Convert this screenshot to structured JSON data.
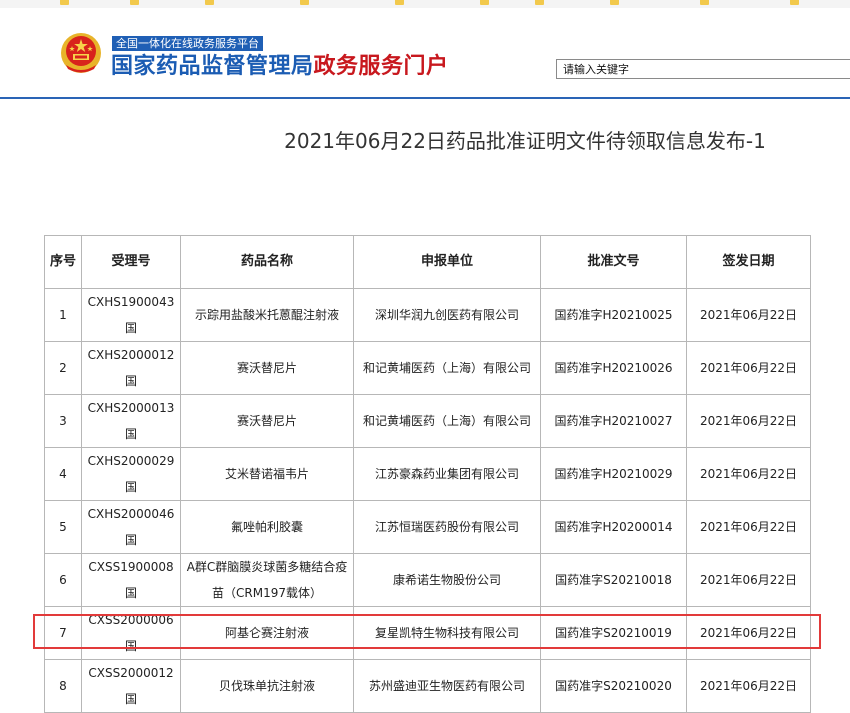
{
  "header": {
    "tagline": "全国一体化在线政务服务平台",
    "title_blue": "国家药品监督管理局",
    "title_red": "政务服务门户",
    "search_placeholder": "请输入关键字",
    "emblem_icon": "national-emblem-icon",
    "colors": {
      "brand_blue": "#1b5cb3",
      "brand_red": "#c8181e",
      "highlight": "#e23a3a"
    }
  },
  "page": {
    "title": "2021年06月22日药品批准证明文件待领取信息发布-1"
  },
  "table": {
    "columns": [
      "序号",
      "受理号",
      "药品名称",
      "申报单位",
      "批准文号",
      "签发日期"
    ],
    "rows": [
      {
        "no": "1",
        "accept": "CXHS1900043国",
        "drug": "示踪用盐酸米托蒽醌注射液",
        "applicant": "深圳华润九创医药有限公司",
        "approval": "国药准字H20210025",
        "date": "2021年06月22日"
      },
      {
        "no": "2",
        "accept": "CXHS2000012国",
        "drug": "赛沃替尼片",
        "applicant": "和记黄埔医药（上海）有限公司",
        "approval": "国药准字H20210026",
        "date": "2021年06月22日"
      },
      {
        "no": "3",
        "accept": "CXHS2000013国",
        "drug": "赛沃替尼片",
        "applicant": "和记黄埔医药（上海）有限公司",
        "approval": "国药准字H20210027",
        "date": "2021年06月22日"
      },
      {
        "no": "4",
        "accept": "CXHS2000029国",
        "drug": "艾米替诺福韦片",
        "applicant": "江苏豪森药业集团有限公司",
        "approval": "国药准字H20210029",
        "date": "2021年06月22日"
      },
      {
        "no": "5",
        "accept": "CXHS2000046国",
        "drug": "氟唑帕利胶囊",
        "applicant": "江苏恒瑞医药股份有限公司",
        "approval": "国药准字H20200014",
        "date": "2021年06月22日"
      },
      {
        "no": "6",
        "accept": "CXSS1900008国",
        "drug": "A群C群脑膜炎球菌多糖结合疫苗（CRM197载体）",
        "applicant": "康希诺生物股份公司",
        "approval": "国药准字S20210018",
        "date": "2021年06月22日"
      },
      {
        "no": "7",
        "accept": "CXSS2000006国",
        "drug": "阿基仑赛注射液",
        "applicant": "复星凯特生物科技有限公司",
        "approval": "国药准字S20210019",
        "date": "2021年06月22日"
      },
      {
        "no": "8",
        "accept": "CXSS2000012国",
        "drug": "贝伐珠单抗注射液",
        "applicant": "苏州盛迪亚生物医药有限公司",
        "approval": "国药准字S20210020",
        "date": "2021年06月22日"
      }
    ]
  }
}
